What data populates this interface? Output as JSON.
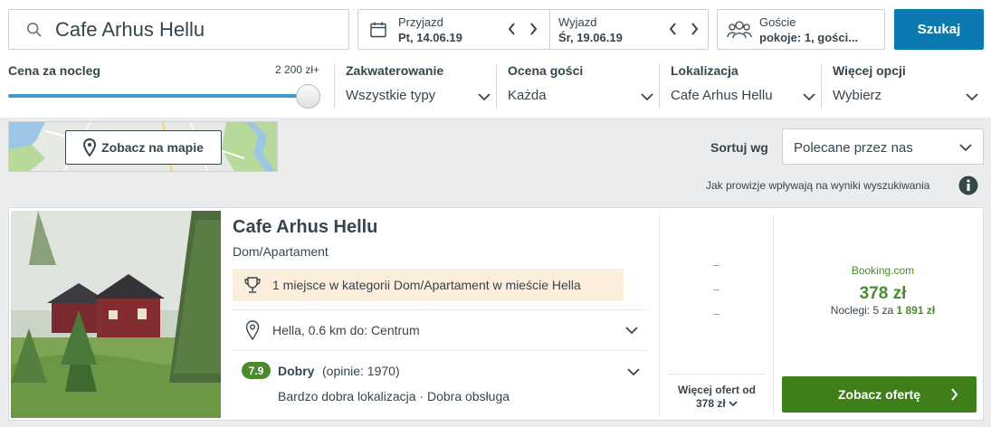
{
  "search": {
    "query": "Cafe Arhus Hellu",
    "button_label": "Szukaj"
  },
  "dates": {
    "checkin_label": "Przyjazd",
    "checkin_value": "Pt, 14.06.19",
    "checkout_label": "Wyjazd",
    "checkout_value": "Śr, 19.06.19"
  },
  "guests": {
    "label": "Goście",
    "value": "pokoje: 1, gości..."
  },
  "filters": {
    "price": {
      "label": "Cena za nocleg",
      "max": "2 200 zł+",
      "level": 1.0
    },
    "accommodation": {
      "label": "Zakwaterowanie",
      "value": "Wszystkie typy"
    },
    "rating": {
      "label": "Ocena gości",
      "value": "Każda"
    },
    "location": {
      "label": "Lokalizacja",
      "value": "Cafe Arhus Hellu"
    },
    "more": {
      "label": "Więcej opcji",
      "value": "Wybierz"
    }
  },
  "map": {
    "button_label": "Zobacz na mapie"
  },
  "sort": {
    "label": "Sortuj wg",
    "value": "Polecane przez nas"
  },
  "commission_note": "Jak prowizje wpływają na wyniki wyszukiwania",
  "result": {
    "name": "Cafe Arhus Hellu",
    "type": "Dom/Apartament",
    "badge": "1 miejsce w kategorii Dom/Apartament w mieście Hella",
    "location": "Hella, 0.6 km do: Centrum",
    "rating_score": "7.9",
    "rating_label": "Dobry",
    "rating_count": "(opinie: 1970)",
    "rating_desc": "Bardzo dobra lokalizacja · Dobra obsługa",
    "more_offers_line1": "Więcej ofert od",
    "more_offers_line2": "378 zł",
    "partner": "Booking.com",
    "price": "378 zł",
    "nights_prefix": "Noclegi: 5 za",
    "nights_total": "1 891 zł",
    "deal_button": "Zobacz ofertę"
  },
  "colors": {
    "accent_blue": "#0a7ab1",
    "deal_green": "#3f7f1a",
    "price_green": "#4a8b2e"
  },
  "icons": [
    "search-icon",
    "calendar-icon",
    "chevron-left-icon",
    "chevron-right-icon",
    "guests-icon",
    "map-pin-icon",
    "chevron-down-icon",
    "info-icon",
    "trophy-icon",
    "location-pin-icon"
  ]
}
